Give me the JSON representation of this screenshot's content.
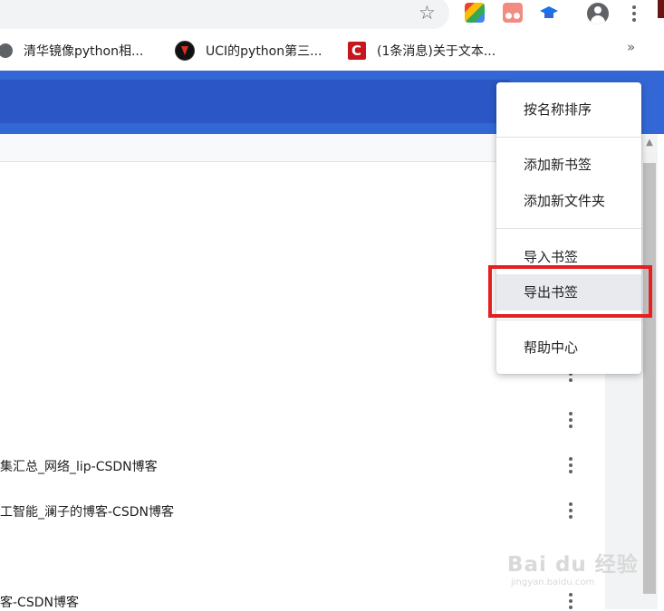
{
  "bookmarks_bar": {
    "items": [
      {
        "label": "清华镜像python相...",
        "icon": "globe-icon"
      },
      {
        "label": "UCI的python第三...",
        "icon": "site-favicon-icon"
      },
      {
        "label": "(1条消息)关于文本...",
        "icon": "csdn-icon"
      }
    ],
    "more_label": "»"
  },
  "toolbar": {
    "star_icon": "star-icon",
    "extensions": [
      "color-extension-icon",
      "tampermonkey-icon",
      "graduation-cap-icon"
    ],
    "profile_icon": "account-circle-icon",
    "menu_icon": "more-vertical-icon"
  },
  "bookmark_rows": [
    {
      "label": "集汇总_网络_lip-CSDN博客"
    },
    {
      "label": "工智能_澜子的博客-CSDN博客"
    },
    {
      "label": "客-CSDN博客"
    }
  ],
  "dropdown_menu": {
    "sort_by_name": "按名称排序",
    "add_bookmark": "添加新书签",
    "add_folder": "添加新文件夹",
    "import_bookmarks": "导入书签",
    "export_bookmarks": "导出书签",
    "help_center": "帮助中心"
  },
  "watermark": {
    "logo": "Bai du 经验",
    "url": "jingyan.baidu.com"
  },
  "colors": {
    "header_blue": "#3367d6",
    "highlight_red": "#e41f1f"
  }
}
